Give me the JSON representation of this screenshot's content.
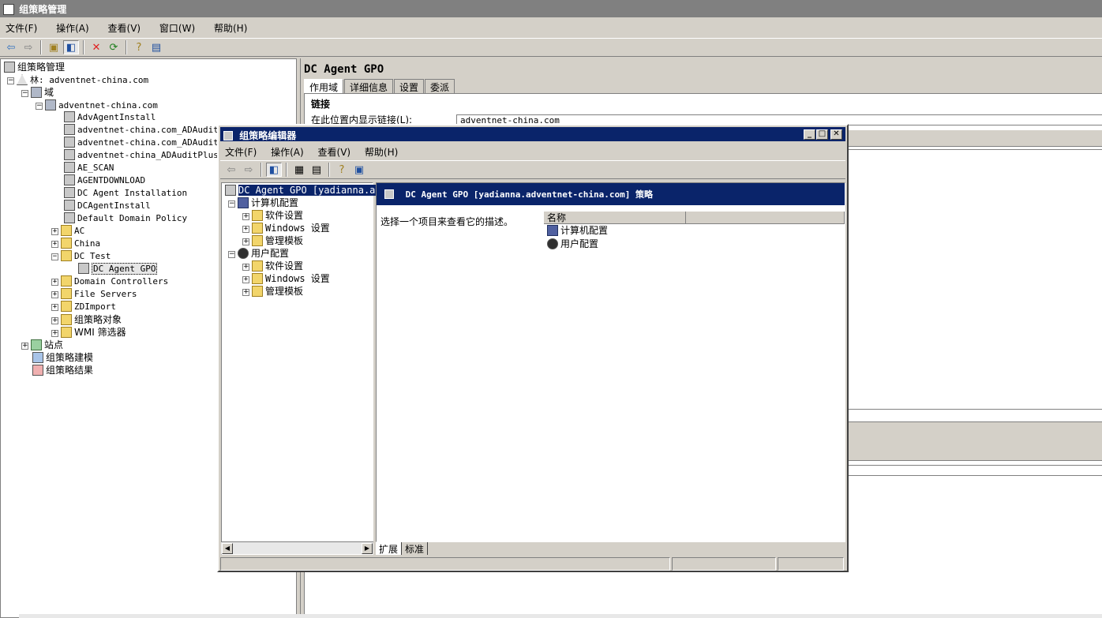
{
  "app": {
    "title": "组策略管理"
  },
  "menubar": {
    "items": [
      "文件(F)",
      "操作(A)",
      "查看(V)",
      "窗口(W)",
      "帮助(H)"
    ]
  },
  "tree": {
    "root": "组策略管理",
    "forest": "林: adventnet-china.com",
    "domains": "域",
    "domain": "adventnet-china.com",
    "gpos": [
      "AdvAgentInstall",
      "adventnet-china.com_ADAuditPl",
      "adventnet-china.com_ADAuditPl",
      "adventnet-china_ADAuditPlusPo",
      "AE_SCAN",
      "AGENTDOWNLOAD",
      "DC Agent Installation",
      "DCAgentInstall",
      "Default Domain Policy"
    ],
    "ous_before": [
      "AC",
      "China"
    ],
    "dc_test": "DC Test",
    "dc_test_child": "DC Agent GPO",
    "ous_after": [
      "Domain Controllers",
      "File Servers",
      "ZDImport",
      "组策略对象",
      "WMI 筛选器"
    ],
    "sites": "站点",
    "modeling": "组策略建模",
    "results": "组策略结果"
  },
  "right": {
    "title": "DC Agent GPO",
    "tabs": [
      "作用域",
      "详细信息",
      "设置",
      "委派"
    ],
    "section": "链接",
    "location_label": "在此位置内显示链接(L):",
    "location_value": "adventnet-china.com"
  },
  "editor": {
    "title": "组策略编辑器",
    "menu": [
      "文件(F)",
      "操作(A)",
      "查看(V)",
      "帮助(H)"
    ],
    "tree_root": "DC Agent GPO [yadianna.adven",
    "computer": "计算机配置",
    "user": "用户配置",
    "sub": [
      "软件设置",
      "Windows 设置",
      "管理模板"
    ],
    "banner": "DC Agent GPO [yadianna.adventnet-china.com] 策略",
    "description": "选择一个项目来查看它的描述。",
    "column_name": "名称",
    "items": [
      "计算机配置",
      "用户配置"
    ],
    "tabs": [
      "扩展",
      "标准"
    ]
  }
}
